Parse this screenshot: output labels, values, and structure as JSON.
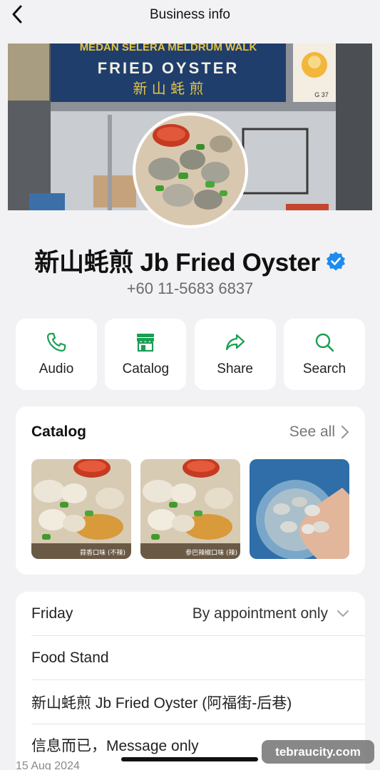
{
  "header": {
    "title": "Business info"
  },
  "cover": {
    "sign_line1": "MEDAN SELERA MELDRUM WALK",
    "sign_line2": "FRIED OYSTER",
    "sign_line3": "新 山 蚝 煎",
    "stall_no": "G 37"
  },
  "business": {
    "name": "新山蚝煎 Jb Fried Oyster",
    "phone": "+60 11-5683 6837",
    "verified_color": "#1d8cf0"
  },
  "actions": [
    {
      "label": "Audio",
      "icon": "phone-icon"
    },
    {
      "label": "Catalog",
      "icon": "storefront-icon"
    },
    {
      "label": "Share",
      "icon": "share-arrow-icon"
    },
    {
      "label": "Search",
      "icon": "search-icon"
    }
  ],
  "catalog": {
    "title": "Catalog",
    "see_all": "See all",
    "items": [
      {
        "caption": "蒜香口味 (不辣)"
      },
      {
        "caption": "参巴辣椒口味 (辣)"
      },
      {
        "caption": ""
      }
    ]
  },
  "info": {
    "day": "Friday",
    "hours": "By appointment only",
    "category": "Food Stand",
    "full_name": "新山蚝煎 Jb Fried Oyster (阿福街-后巷)",
    "about": "信息而已，Message only",
    "about_date": "15 Aug 2024"
  },
  "watermark": "tebraucity.com",
  "colors": {
    "accent": "#1a9e54",
    "background": "#f2f2f4"
  }
}
